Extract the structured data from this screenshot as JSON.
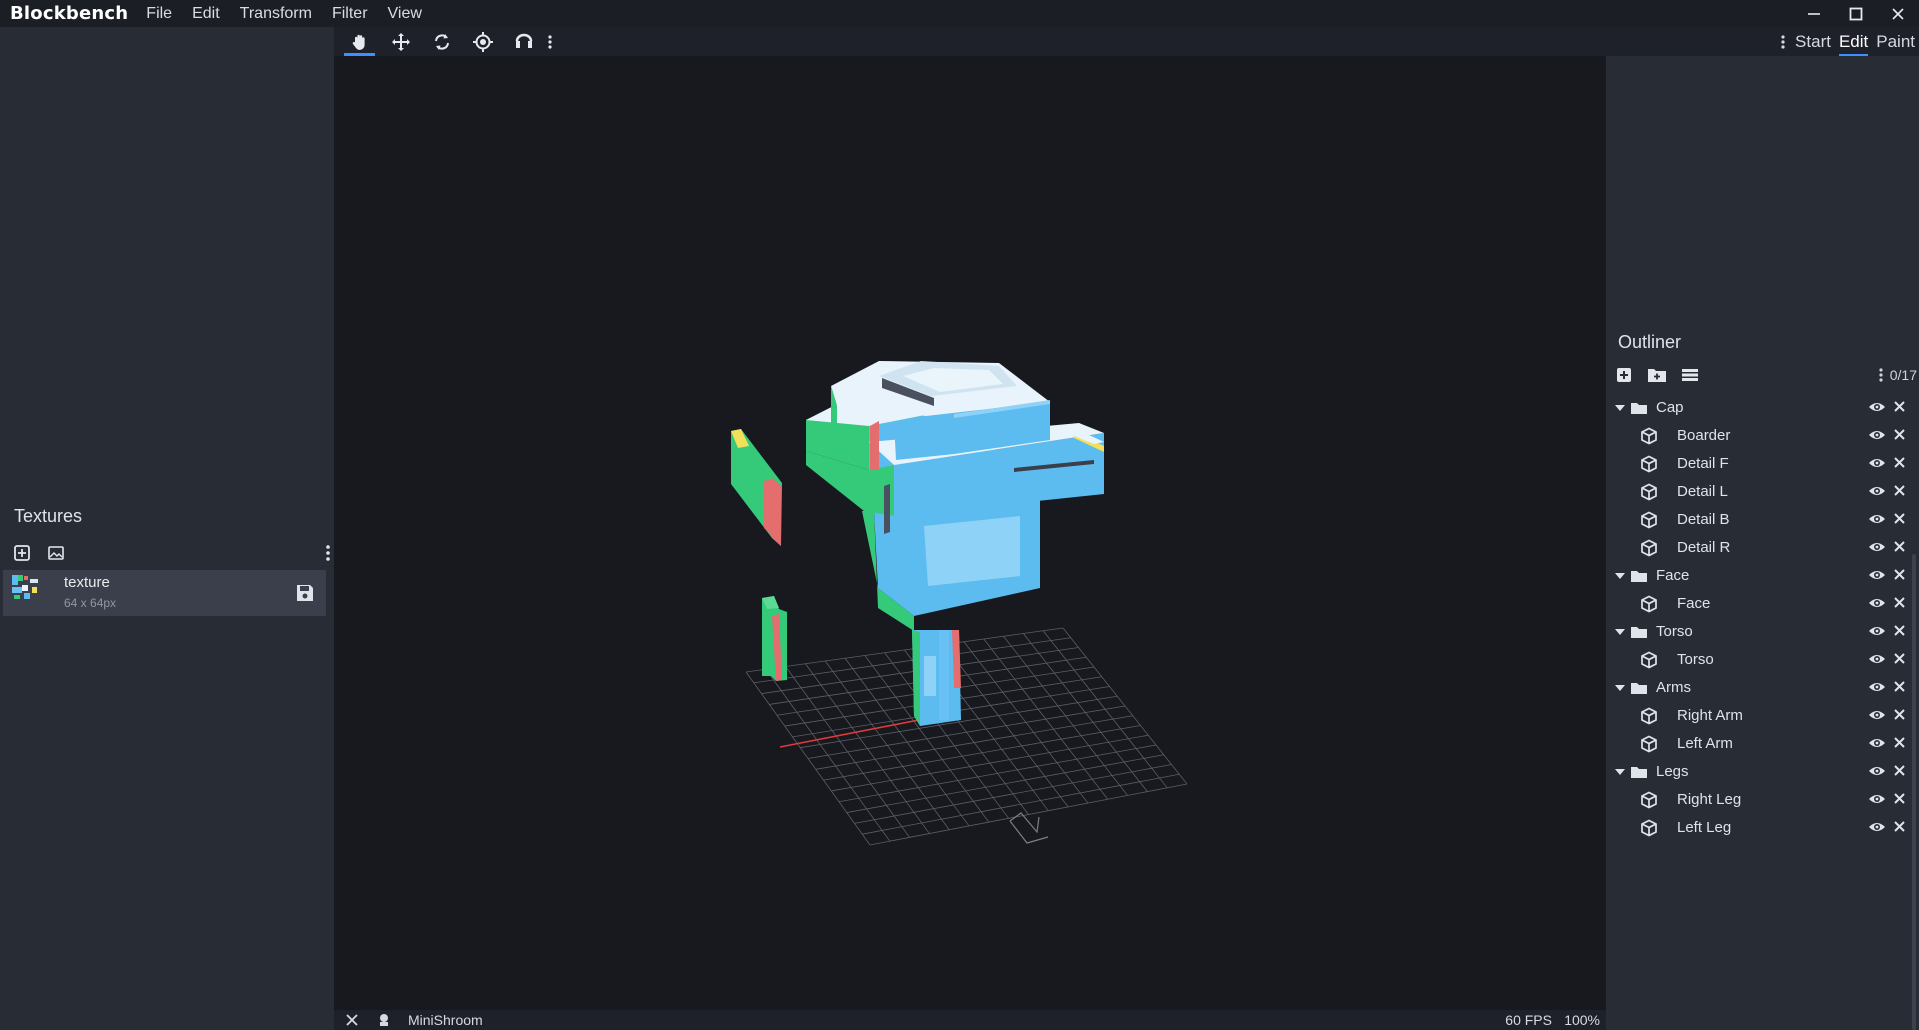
{
  "app": {
    "name": "Blockbench"
  },
  "menu": [
    "File",
    "Edit",
    "Transform",
    "Filter",
    "View"
  ],
  "mode_tabs": {
    "start": "Start",
    "edit": "Edit",
    "paint": "Paint",
    "active": "Edit"
  },
  "textures": {
    "title": "Textures",
    "items": [
      {
        "name": "texture",
        "size": "64 x 64px"
      }
    ]
  },
  "outliner": {
    "title": "Outliner",
    "count": "0/17",
    "items": [
      {
        "label": "Cap",
        "type": "group",
        "depth": 0
      },
      {
        "label": "Boarder",
        "type": "cube",
        "depth": 1
      },
      {
        "label": "Detail F",
        "type": "cube",
        "depth": 1
      },
      {
        "label": "Detail L",
        "type": "cube",
        "depth": 1
      },
      {
        "label": "Detail B",
        "type": "cube",
        "depth": 1
      },
      {
        "label": "Detail R",
        "type": "cube",
        "depth": 1
      },
      {
        "label": "Face",
        "type": "group",
        "depth": 0
      },
      {
        "label": "Face",
        "type": "cube",
        "depth": 1
      },
      {
        "label": "Torso",
        "type": "group",
        "depth": 0
      },
      {
        "label": "Torso",
        "type": "cube",
        "depth": 1
      },
      {
        "label": "Arms",
        "type": "group",
        "depth": 0
      },
      {
        "label": "Right Arm",
        "type": "cube",
        "depth": 1
      },
      {
        "label": "Left Arm",
        "type": "cube",
        "depth": 1
      },
      {
        "label": "Legs",
        "type": "group",
        "depth": 0
      },
      {
        "label": "Right Leg",
        "type": "cube",
        "depth": 1
      },
      {
        "label": "Left Leg",
        "type": "cube",
        "depth": 1
      }
    ]
  },
  "status": {
    "project": "MiniShroom",
    "fps": "60 FPS",
    "zoom": "100%"
  },
  "colors": {
    "accent": "#3e90ff",
    "viewport_bg": "#17191e",
    "panel_bg": "#282c35"
  }
}
